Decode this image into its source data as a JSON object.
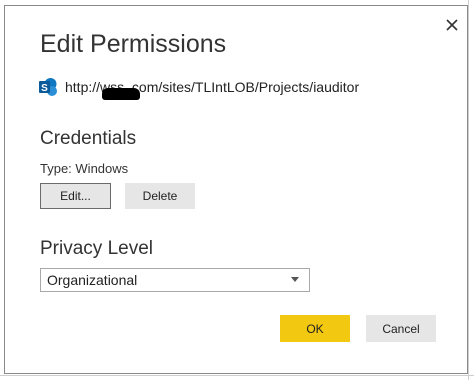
{
  "dialog": {
    "title": "Edit Permissions",
    "url": "http://wss        .com/sites/TLIntLOB/Projects/iauditor",
    "close_icon": "close-icon",
    "site_icon": "sharepoint-icon"
  },
  "credentials": {
    "heading": "Credentials",
    "type_label": "Type: Windows",
    "edit_label": "Edit...",
    "delete_label": "Delete"
  },
  "privacy": {
    "heading": "Privacy Level",
    "selected": "Organizational"
  },
  "footer": {
    "ok_label": "OK",
    "cancel_label": "Cancel"
  },
  "colors": {
    "ok_button": "#f2c811",
    "secondary_button": "#e6e6e6",
    "sharepoint_blue": "#0f78c0"
  }
}
